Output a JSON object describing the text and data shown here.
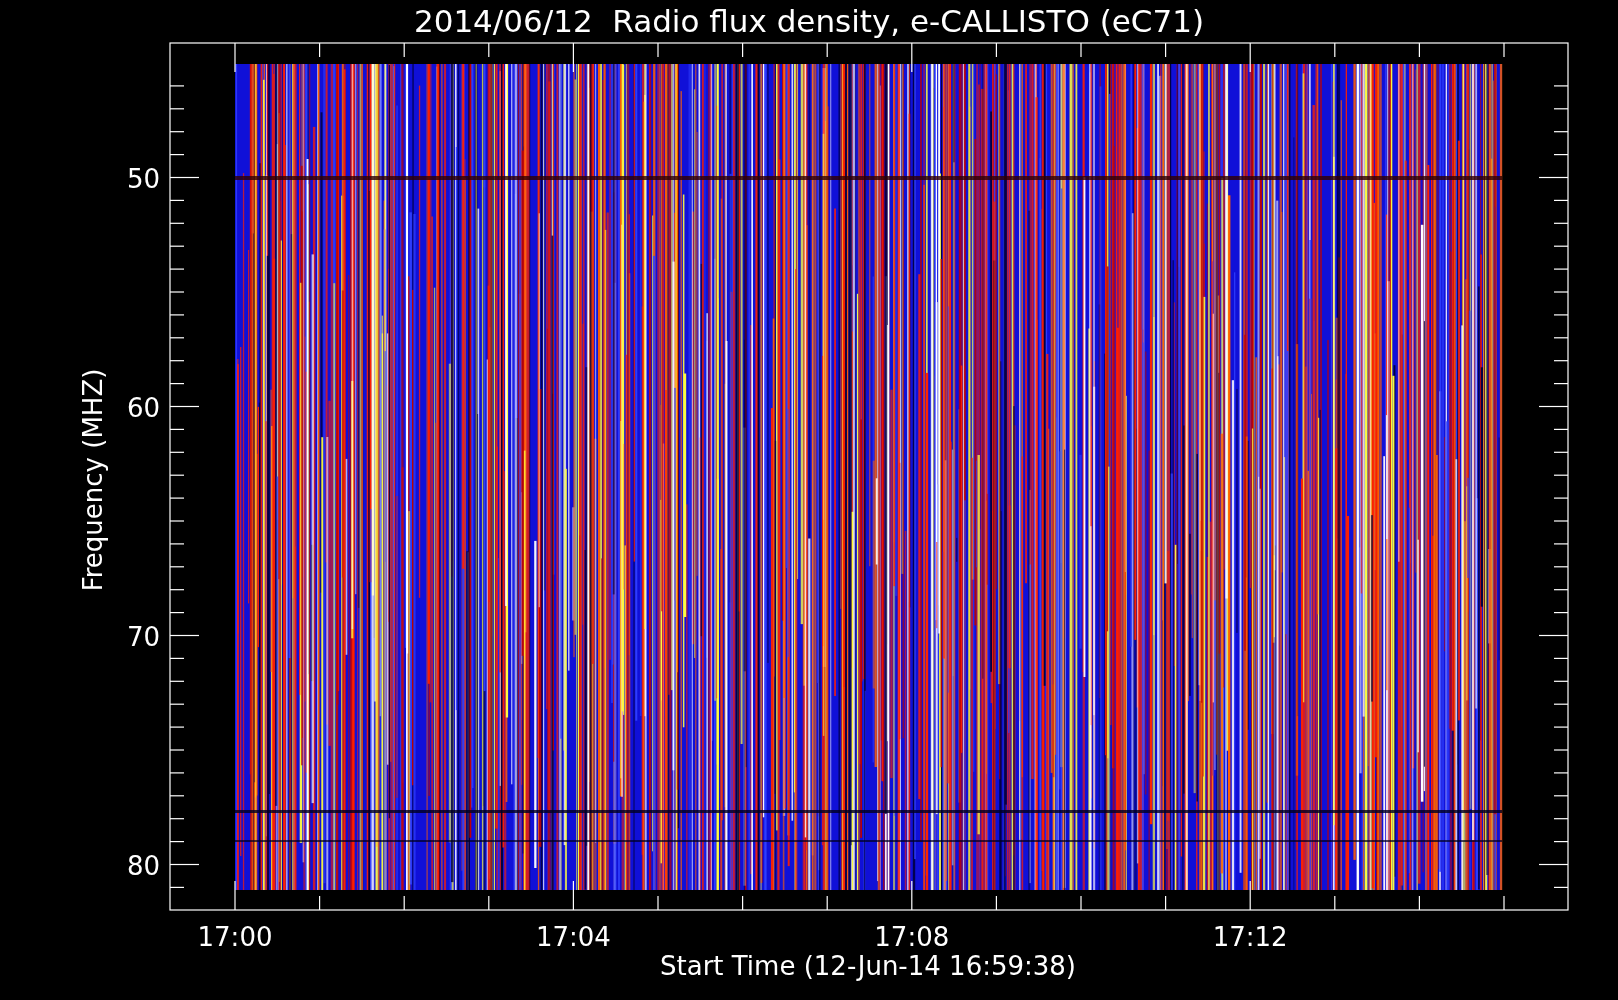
{
  "title": "2014/06/12  Radio flux density, e-CALLISTO (eC71)",
  "plot": {
    "ylabel": "Frequency (MHZ)",
    "xlabel": "Start Time (12-Jun-14 16:59:38)",
    "yticks": [
      "50",
      "60",
      "70",
      "80"
    ],
    "xticks": [
      "17:00",
      "17:04",
      "17:08",
      "17:12"
    ]
  }
}
